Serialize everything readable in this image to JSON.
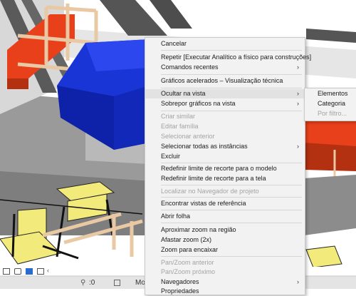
{
  "context_menu": {
    "items": [
      {
        "label": "Cancelar",
        "disabled": false,
        "submenu": false
      },
      {
        "label": "Repetir [Executar Analítico a físico para construções]",
        "disabled": false,
        "submenu": false
      },
      {
        "label": "Comandos recentes",
        "disabled": false,
        "submenu": true
      },
      {
        "label": "Gráficos acelerados – Visualização técnica",
        "disabled": false,
        "submenu": false
      },
      {
        "label": "Ocultar na vista",
        "disabled": false,
        "submenu": true,
        "highlighted": true
      },
      {
        "label": "Sobrepor gráficos na vista",
        "disabled": false,
        "submenu": true
      },
      {
        "label": "Criar similar",
        "disabled": true,
        "submenu": false
      },
      {
        "label": "Editar família",
        "disabled": true,
        "submenu": false
      },
      {
        "label": "Selecionar anterior",
        "disabled": true,
        "submenu": false
      },
      {
        "label": "Selecionar todas as instâncias",
        "disabled": false,
        "submenu": true
      },
      {
        "label": "Excluir",
        "disabled": false,
        "submenu": false
      },
      {
        "label": "Redefinir limite de recorte para o modelo",
        "disabled": false,
        "submenu": false
      },
      {
        "label": "Redefinir limite de recorte para a tela",
        "disabled": false,
        "submenu": false
      },
      {
        "label": "Localizar no Navegador de projeto",
        "disabled": true,
        "submenu": false
      },
      {
        "label": "Encontrar vistas de referência",
        "disabled": false,
        "submenu": false
      },
      {
        "label": "Abrir folha",
        "disabled": false,
        "submenu": false
      },
      {
        "label": "Aproximar zoom na região",
        "disabled": false,
        "submenu": false
      },
      {
        "label": "Afastar zoom (2x)",
        "disabled": false,
        "submenu": false
      },
      {
        "label": "Zoom para encaixar",
        "disabled": false,
        "submenu": false
      },
      {
        "label": "Pan/Zoom anterior",
        "disabled": true,
        "submenu": false
      },
      {
        "label": "Pan/Zoom próximo",
        "disabled": true,
        "submenu": false
      },
      {
        "label": "Navegadores",
        "disabled": false,
        "submenu": true
      },
      {
        "label": "Propriedades",
        "disabled": false,
        "submenu": false
      }
    ]
  },
  "submenu": {
    "items": [
      {
        "label": "Elementos",
        "disabled": false
      },
      {
        "label": "Categoria",
        "disabled": false
      },
      {
        "label": "Por filtro...",
        "disabled": true
      }
    ]
  },
  "status_bar": {
    "selection_count": ":0",
    "model_label": "Mo"
  },
  "colors": {
    "menu_bg": "#f2f2f2",
    "menu_highlight": "#e2e2e2",
    "sofa_blue": "#1530d0",
    "sofa_orange": "#e8401a",
    "chair_yellow": "#f2ea7a",
    "wood": "#e9c9a4"
  }
}
